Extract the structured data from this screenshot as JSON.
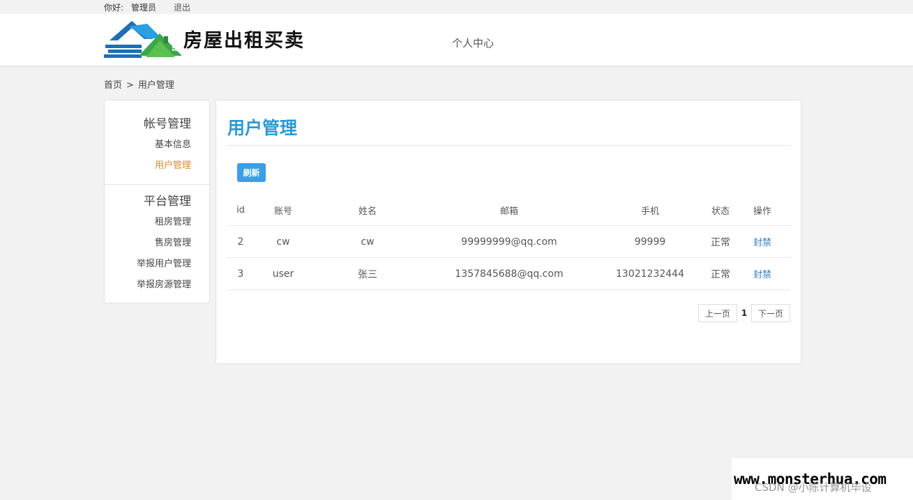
{
  "topbar": {
    "greeting": "你好:",
    "username": "管理员",
    "logout": "退出"
  },
  "header": {
    "site_name": "房屋出租买卖",
    "nav_personal": "个人中心"
  },
  "breadcrumb": {
    "home": "首页",
    "separator": ">",
    "current": "用户管理"
  },
  "sidebar": {
    "group1_title": "帐号管理",
    "group1_items": [
      "基本信息",
      "用户管理"
    ],
    "group2_title": "平台管理",
    "group2_items": [
      "租房管理",
      "售房管理",
      "举报用户管理",
      "举报房源管理"
    ],
    "active_color": "#e08a2c"
  },
  "panel": {
    "title": "用户管理",
    "refresh_label": "刷新",
    "table": {
      "headers": [
        "id",
        "账号",
        "姓名",
        "邮箱",
        "手机",
        "状态",
        "操作"
      ],
      "rows": [
        [
          "2",
          "cw",
          "cw",
          "99999999@qq.com",
          "99999",
          "正常",
          "封禁"
        ],
        [
          "3",
          "user",
          "张三",
          "1357845688@qq.com",
          "13021232444",
          "正常",
          "封禁"
        ]
      ]
    },
    "pager": {
      "prev": "上一页",
      "current": "1",
      "next": "下一页"
    }
  },
  "watermark": {
    "site": "www.monsterhua.com",
    "csdn": "CSDN @小陈计算机毕设"
  },
  "colors": {
    "accent": "#2b9ad4",
    "button": "#3a9ee8",
    "link": "#2b7fc9"
  }
}
